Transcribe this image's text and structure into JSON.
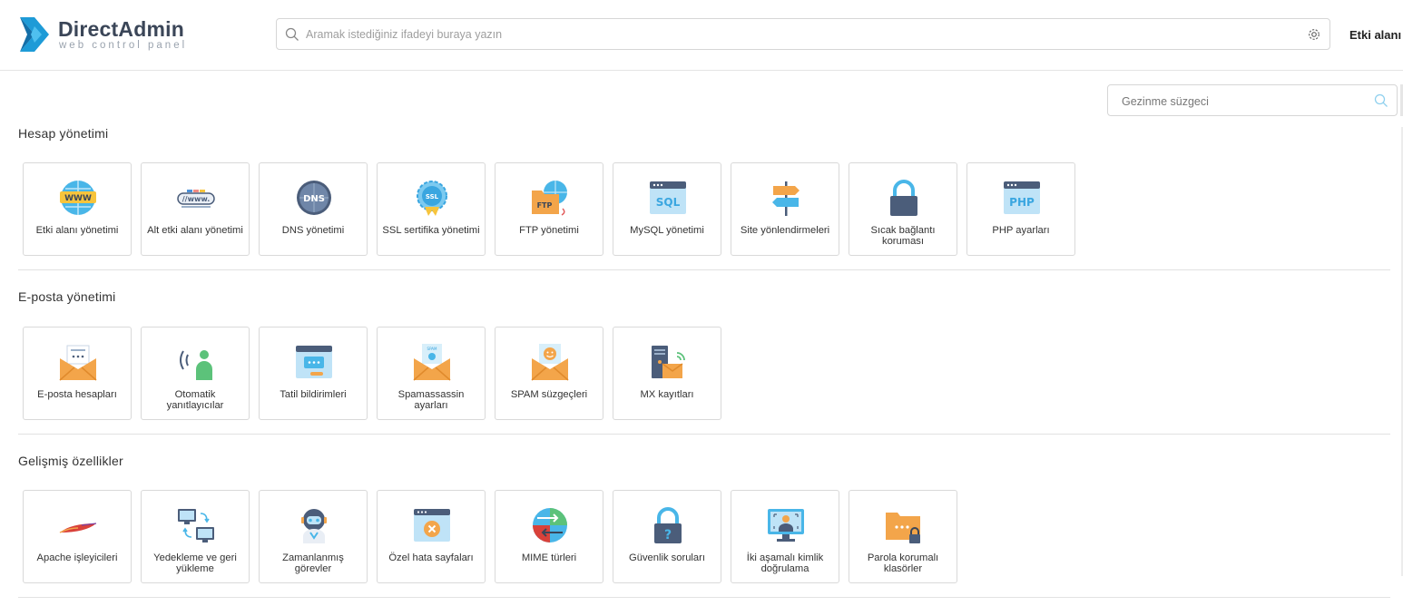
{
  "header": {
    "logo_title": "DirectAdmin",
    "logo_subtitle": "web control panel",
    "search_placeholder": "Aramak istediğiniz ifadeyi buraya yazın",
    "domain_label": "Etki alanı"
  },
  "filter": {
    "placeholder": "Gezinme süzgeci"
  },
  "sections": [
    {
      "title": "Hesap yönetimi",
      "items": [
        {
          "label": "Etki alanı yönetimi",
          "icon": "globe-www-icon"
        },
        {
          "label": "Alt etki alanı yönetimi",
          "icon": "subdomain-www-icon"
        },
        {
          "label": "DNS yönetimi",
          "icon": "dns-globe-icon"
        },
        {
          "label": "SSL sertifika yönetimi",
          "icon": "ssl-badge-icon"
        },
        {
          "label": "FTP yönetimi",
          "icon": "ftp-folder-icon"
        },
        {
          "label": "MySQL yönetimi",
          "icon": "mysql-window-icon"
        },
        {
          "label": "Site yönlendirmeleri",
          "icon": "signpost-icon"
        },
        {
          "label": "Sıcak bağlantı koruması",
          "icon": "padlock-icon"
        },
        {
          "label": "PHP ayarları",
          "icon": "php-window-icon"
        }
      ]
    },
    {
      "title": "E-posta yönetimi",
      "items": [
        {
          "label": "E-posta hesapları",
          "icon": "envelope-icon"
        },
        {
          "label": "Otomatik yanıtlayıcılar",
          "icon": "autoresponder-person-icon"
        },
        {
          "label": "Tatil bildirimleri",
          "icon": "vacation-message-icon"
        },
        {
          "label": "Spamassassin ayarları",
          "icon": "spam-envelope-icon"
        },
        {
          "label": "SPAM süzgeçleri",
          "icon": "spam-filter-envelope-icon"
        },
        {
          "label": "MX kayıtları",
          "icon": "mx-server-icon"
        }
      ]
    },
    {
      "title": "Gelişmiş özellikler",
      "items": [
        {
          "label": "Apache işleyicileri",
          "icon": "apache-feather-icon"
        },
        {
          "label": "Yedekleme ve geri yükleme",
          "icon": "backup-computers-icon"
        },
        {
          "label": "Zamanlanmış görevler",
          "icon": "cron-robot-icon"
        },
        {
          "label": "Özel hata sayfaları",
          "icon": "error-page-icon"
        },
        {
          "label": "MIME türleri",
          "icon": "mime-globe-icon"
        },
        {
          "label": "Güvenlik soruları",
          "icon": "security-question-lock-icon"
        },
        {
          "label": "İki aşamalı kimlik doğrulama",
          "icon": "two-factor-screen-icon"
        },
        {
          "label": "Parola korumalı klasörler",
          "icon": "protected-folder-icon"
        }
      ]
    }
  ],
  "colors": {
    "accent": "#1e9bd7",
    "text": "#333333",
    "border": "#d9d9d9"
  }
}
